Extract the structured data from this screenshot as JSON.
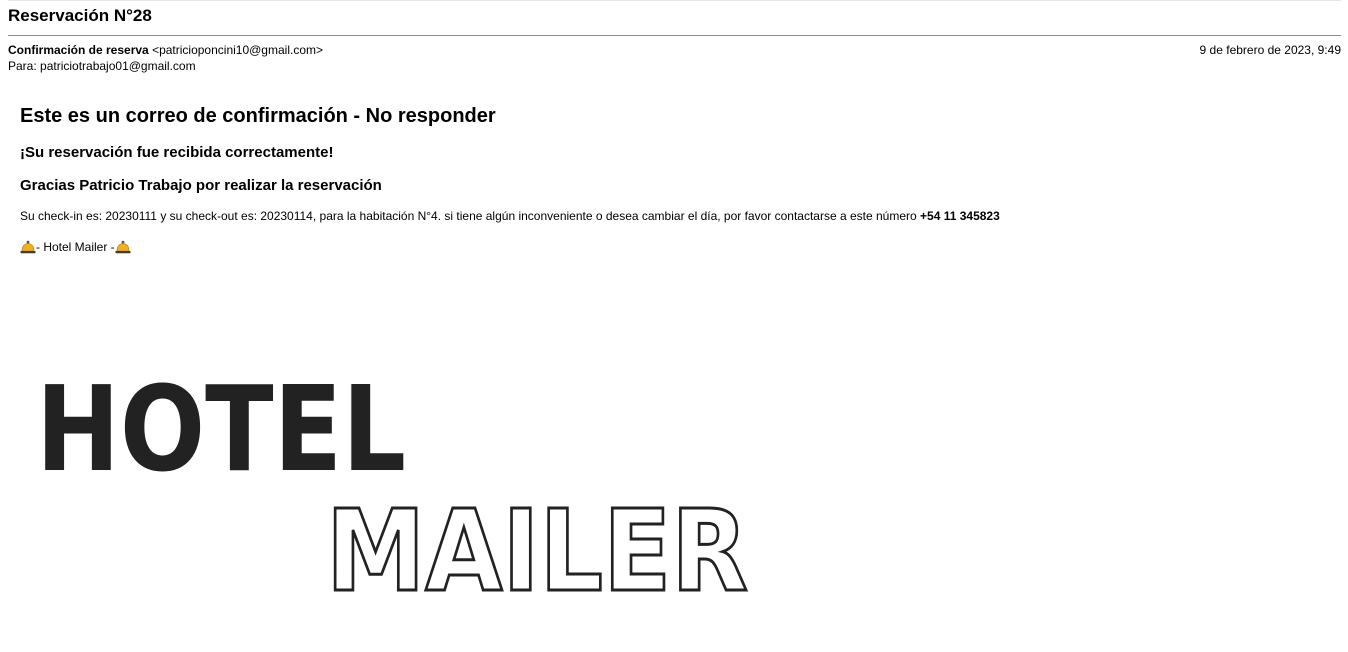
{
  "email": {
    "subject": "Reservación N°28",
    "from_name": "Confirmación de reserva",
    "from_address": "<patricioponcini10@gmail.com>",
    "to_line": "Para: patriciotrabajo01@gmail.com",
    "date": "9 de febrero de 2023, 9:49"
  },
  "message": {
    "heading": "Este es un correo de confirmación - No responder",
    "received": "¡Su reservación fue recibida correctamente!",
    "thanks": "Gracias Patricio Trabajo por realizar la reservación",
    "details_text": "Su check-in es: 20230111 y su check-out es: 20230114, para la habitación N°4. si tiene algún inconveniente o desea cambiar el día, por favor contactarse a este número ",
    "phone": "+54 11 345823",
    "signature": "- Hotel Mailer -",
    "bell_icon": "bell-icon"
  },
  "logo": {
    "word1": "HOTEL",
    "word2": "MAILER"
  },
  "colors": {
    "text": "#000000",
    "logo_dark": "#222222",
    "bell": "#f2b01e"
  }
}
